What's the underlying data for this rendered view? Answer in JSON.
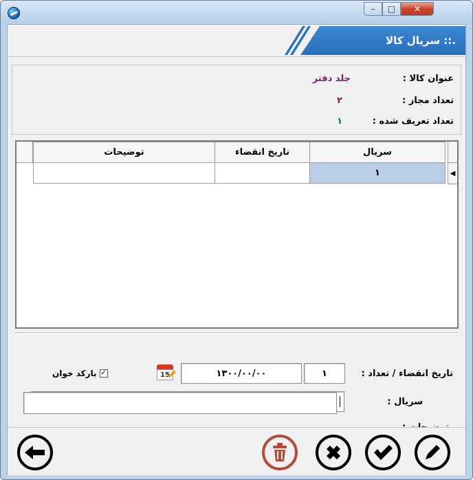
{
  "window": {
    "controls": {
      "minimize": "–",
      "maximize": "□",
      "close": "✕"
    }
  },
  "header": {
    "title": ".:: سریال کالا"
  },
  "info": {
    "product_label": "عنوان کالا :",
    "product_value": "جلد دفتر",
    "allowed_label": "تعداد مجاز :",
    "allowed_value": "۲",
    "defined_label": "تعداد تعریف شده :",
    "defined_value": "۱",
    "colors": {
      "product_value": "#7a1f6e",
      "allowed_value": "#8b1a1a",
      "defined_value": "#0b6b6b"
    }
  },
  "grid": {
    "columns": [
      "سریال",
      "تاریخ انقضاء",
      "توضیحات"
    ],
    "rows": [
      {
        "serial": "۱",
        "expiry": "",
        "notes": ""
      }
    ]
  },
  "form": {
    "expiry_count_label": "تاریخ انقضاء / تعداد :",
    "count_value": "۱",
    "date_value": "۱۳۰۰/۰۰/۰۰",
    "calendar_day": "15",
    "barcode_label": "بارکد خوان",
    "barcode_checked": "✓",
    "serial_label": "سریال :",
    "serial_value": "",
    "notes_label": "توضیحات :",
    "notes_value": ""
  },
  "toolbar": {
    "buttons": [
      "back-arrow-icon",
      "delete-icon",
      "cancel-icon",
      "confirm-icon",
      "edit-icon"
    ],
    "delete_color": "#b04a3c"
  }
}
